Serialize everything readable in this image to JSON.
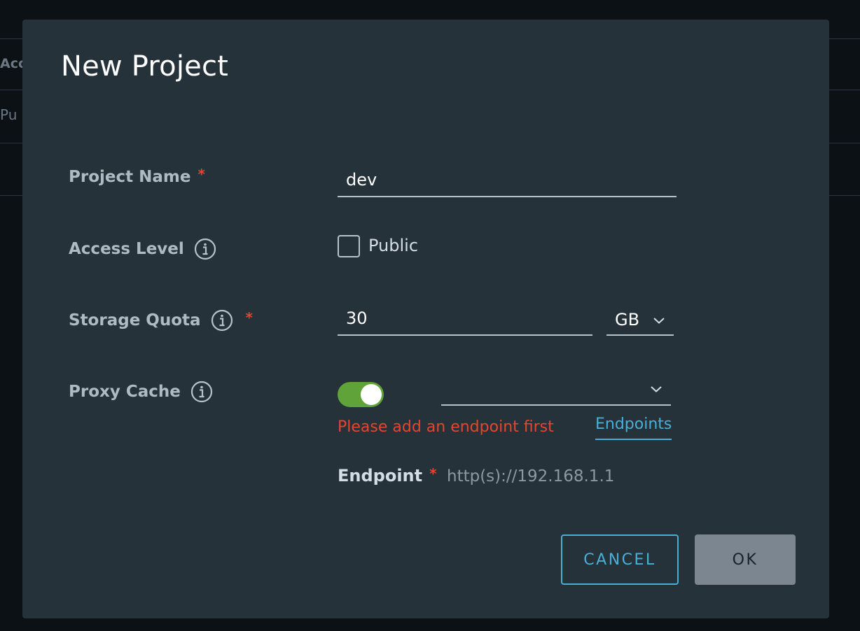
{
  "background": {
    "column_header": "Acc",
    "row_cell": "Pu"
  },
  "dialog": {
    "title": "New Project",
    "project_name": {
      "label": "Project Name",
      "required_mark": "*",
      "value": "dev"
    },
    "access_level": {
      "label": "Access Level",
      "checkbox_label": "Public",
      "checked": false
    },
    "storage_quota": {
      "label": "Storage Quota",
      "required_mark": "*",
      "value": "30",
      "unit": "GB"
    },
    "proxy_cache": {
      "label": "Proxy Cache",
      "enabled": true,
      "error": "Please add an endpoint first",
      "link_label": "Endpoints",
      "endpoint_label": "Endpoint",
      "required_mark": "*",
      "endpoint_placeholder": "http(s)://192.168.1.1"
    },
    "buttons": {
      "cancel": "CANCEL",
      "ok": "OK"
    }
  },
  "icons": {
    "info": "info-circle-icon",
    "chevron": "chevron-down-icon"
  },
  "colors": {
    "modal_bg": "#253239",
    "accent": "#49afd9",
    "toggle_on": "#5fa339",
    "error": "#e6452e"
  }
}
